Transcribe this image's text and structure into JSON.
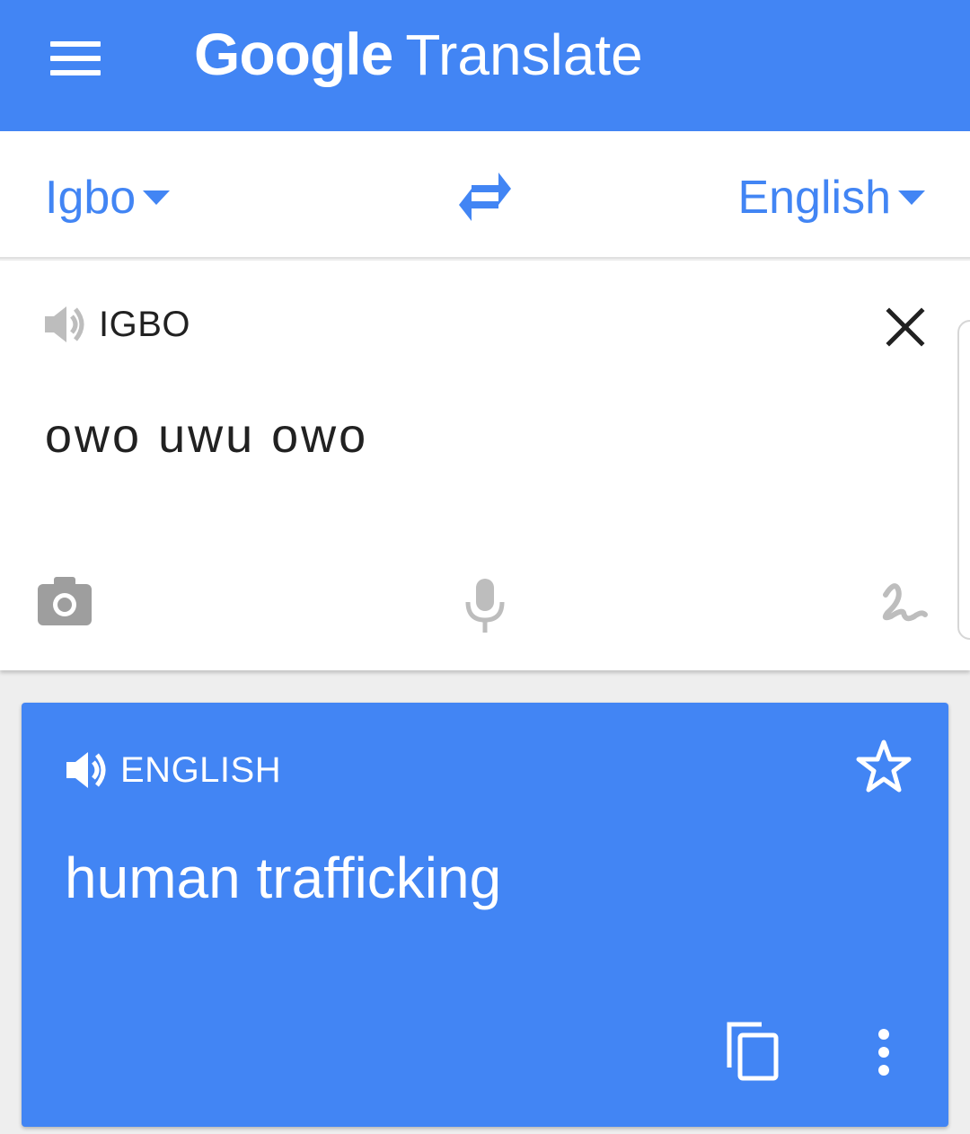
{
  "appbar": {
    "brand": "Google",
    "product": "Translate",
    "menu_icon": "hamburger-menu-icon",
    "color": "#4285f4"
  },
  "language_bar": {
    "source_language": "Igbo",
    "target_language": "English",
    "swap_icon": "swap-arrows-icon"
  },
  "input": {
    "language_label": "IGBO",
    "text": "owo uwu owo",
    "icons": [
      "speaker-icon",
      "close-icon",
      "camera-icon",
      "microphone-icon",
      "handwriting-icon"
    ]
  },
  "result": {
    "language_label": "ENGLISH",
    "text": "human trafficking",
    "icons": [
      "speaker-icon",
      "star-icon",
      "copy-icon",
      "more-vert-icon"
    ]
  },
  "colors": {
    "accent": "#4285f4",
    "icon_gray": "#9e9e9e",
    "text_dark": "#212121"
  }
}
